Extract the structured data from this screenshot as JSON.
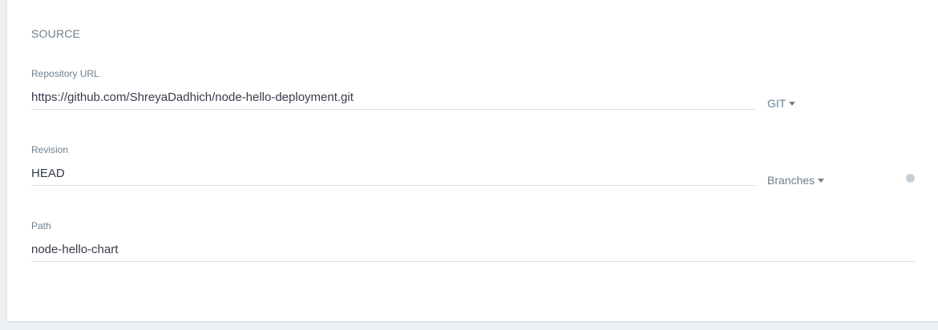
{
  "section": {
    "title": "SOURCE"
  },
  "repository": {
    "label": "Repository URL",
    "value": "https://github.com/ShreyaDadhich/node-hello-deployment.git",
    "type_selector": "GIT"
  },
  "revision": {
    "label": "Revision",
    "value": "HEAD",
    "type_selector": "Branches",
    "help_icon": "question-circle-icon"
  },
  "path": {
    "label": "Path",
    "value": "node-hello-chart"
  },
  "colors": {
    "label": "#6d7f8b",
    "text": "#363c4a",
    "underline": "#d5dbe0",
    "background": "#eef1f4"
  }
}
